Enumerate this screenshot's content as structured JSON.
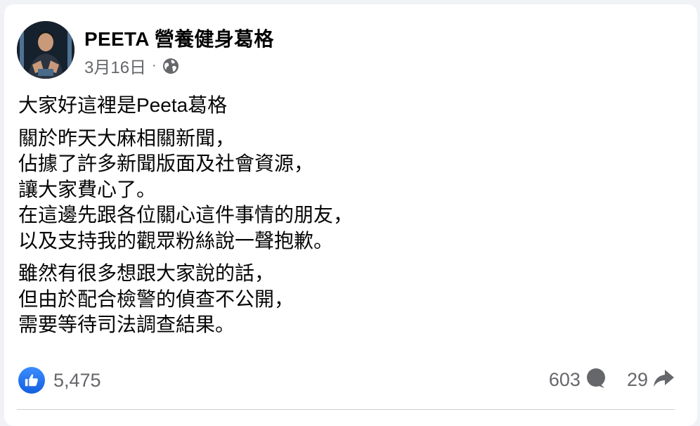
{
  "post": {
    "author": "PEETA 營養健身葛格",
    "date": "3月16日",
    "separator": "·",
    "privacy_icon": "globe-icon",
    "paragraphs": [
      [
        "大家好這裡是Peeta葛格"
      ],
      [
        "關於昨天大麻相關新聞，",
        "佔據了許多新聞版面及社會資源，",
        "讓大家費心了。",
        "在這邊先跟各位關心這件事情的朋友，",
        "以及支持我的觀眾粉絲說一聲抱歉。"
      ],
      [
        "雖然有很多想跟大家說的話，",
        "但由於配合檢警的偵查不公開，",
        "需要等待司法調查結果。"
      ]
    ]
  },
  "stats": {
    "reactions": "5,475",
    "reaction_icon": "like-icon",
    "comments": "603",
    "comment_icon": "comment-icon",
    "shares": "29",
    "share_icon": "share-icon"
  },
  "colors": {
    "like_blue": "#1877f2",
    "secondary_text": "#65676b",
    "primary_text": "#050505"
  }
}
